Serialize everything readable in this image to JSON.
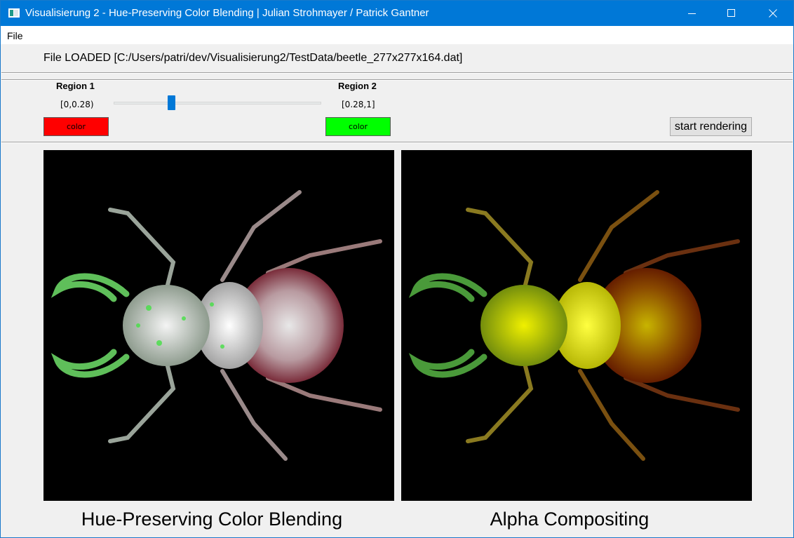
{
  "window": {
    "title": "Visualisierung 2 - Hue-Preserving Color Blending | Julian Strohmayer / Patrick Gantner",
    "icon": "app-window-icon"
  },
  "menu": {
    "items": [
      {
        "label": "File"
      }
    ]
  },
  "status": {
    "file_loaded": "File LOADED [C:/Users/patri/dev/Visualisierung2/TestData/beetle_277x277x164.dat]"
  },
  "controls": {
    "region1": {
      "title": "Region 1",
      "range": "[0,0.28)",
      "color_label": "color",
      "color": "#ff0000"
    },
    "region2": {
      "title": "Region 2",
      "range": "[0.28,1]",
      "color_label": "color",
      "color": "#00ff00"
    },
    "threshold": 0.28,
    "start_label": "start rendering"
  },
  "views": [
    {
      "caption": "Hue-Preserving Color Blending"
    },
    {
      "caption": "Alpha Compositing"
    }
  ],
  "colors": {
    "titlebar": "#0078d7",
    "accent": "#0078d7"
  }
}
